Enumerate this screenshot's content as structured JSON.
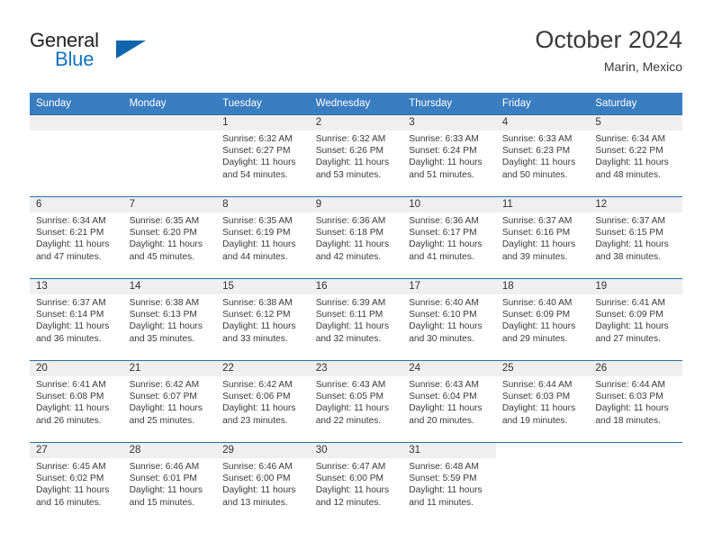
{
  "brand": {
    "word_one": "General",
    "word_two": "Blue",
    "triangle_icon": "triangle-logo-icon"
  },
  "header": {
    "month_title": "October 2024",
    "location": "Marin, Mexico"
  },
  "calendar": {
    "weekday_headers": [
      "Sunday",
      "Monday",
      "Tuesday",
      "Wednesday",
      "Thursday",
      "Friday",
      "Saturday"
    ],
    "labels": {
      "sunrise_prefix": "Sunrise:",
      "sunset_prefix": "Sunset:",
      "daylight_prefix": "Daylight:"
    },
    "weeks": [
      [
        {
          "day": "",
          "sunrise": "",
          "sunset": "",
          "daylight_line1": "",
          "daylight_line2": ""
        },
        {
          "day": "",
          "sunrise": "",
          "sunset": "",
          "daylight_line1": "",
          "daylight_line2": ""
        },
        {
          "day": "1",
          "sunrise": "Sunrise: 6:32 AM",
          "sunset": "Sunset: 6:27 PM",
          "daylight_line1": "Daylight: 11 hours",
          "daylight_line2": "and 54 minutes."
        },
        {
          "day": "2",
          "sunrise": "Sunrise: 6:32 AM",
          "sunset": "Sunset: 6:26 PM",
          "daylight_line1": "Daylight: 11 hours",
          "daylight_line2": "and 53 minutes."
        },
        {
          "day": "3",
          "sunrise": "Sunrise: 6:33 AM",
          "sunset": "Sunset: 6:24 PM",
          "daylight_line1": "Daylight: 11 hours",
          "daylight_line2": "and 51 minutes."
        },
        {
          "day": "4",
          "sunrise": "Sunrise: 6:33 AM",
          "sunset": "Sunset: 6:23 PM",
          "daylight_line1": "Daylight: 11 hours",
          "daylight_line2": "and 50 minutes."
        },
        {
          "day": "5",
          "sunrise": "Sunrise: 6:34 AM",
          "sunset": "Sunset: 6:22 PM",
          "daylight_line1": "Daylight: 11 hours",
          "daylight_line2": "and 48 minutes."
        }
      ],
      [
        {
          "day": "6",
          "sunrise": "Sunrise: 6:34 AM",
          "sunset": "Sunset: 6:21 PM",
          "daylight_line1": "Daylight: 11 hours",
          "daylight_line2": "and 47 minutes."
        },
        {
          "day": "7",
          "sunrise": "Sunrise: 6:35 AM",
          "sunset": "Sunset: 6:20 PM",
          "daylight_line1": "Daylight: 11 hours",
          "daylight_line2": "and 45 minutes."
        },
        {
          "day": "8",
          "sunrise": "Sunrise: 6:35 AM",
          "sunset": "Sunset: 6:19 PM",
          "daylight_line1": "Daylight: 11 hours",
          "daylight_line2": "and 44 minutes."
        },
        {
          "day": "9",
          "sunrise": "Sunrise: 6:36 AM",
          "sunset": "Sunset: 6:18 PM",
          "daylight_line1": "Daylight: 11 hours",
          "daylight_line2": "and 42 minutes."
        },
        {
          "day": "10",
          "sunrise": "Sunrise: 6:36 AM",
          "sunset": "Sunset: 6:17 PM",
          "daylight_line1": "Daylight: 11 hours",
          "daylight_line2": "and 41 minutes."
        },
        {
          "day": "11",
          "sunrise": "Sunrise: 6:37 AM",
          "sunset": "Sunset: 6:16 PM",
          "daylight_line1": "Daylight: 11 hours",
          "daylight_line2": "and 39 minutes."
        },
        {
          "day": "12",
          "sunrise": "Sunrise: 6:37 AM",
          "sunset": "Sunset: 6:15 PM",
          "daylight_line1": "Daylight: 11 hours",
          "daylight_line2": "and 38 minutes."
        }
      ],
      [
        {
          "day": "13",
          "sunrise": "Sunrise: 6:37 AM",
          "sunset": "Sunset: 6:14 PM",
          "daylight_line1": "Daylight: 11 hours",
          "daylight_line2": "and 36 minutes."
        },
        {
          "day": "14",
          "sunrise": "Sunrise: 6:38 AM",
          "sunset": "Sunset: 6:13 PM",
          "daylight_line1": "Daylight: 11 hours",
          "daylight_line2": "and 35 minutes."
        },
        {
          "day": "15",
          "sunrise": "Sunrise: 6:38 AM",
          "sunset": "Sunset: 6:12 PM",
          "daylight_line1": "Daylight: 11 hours",
          "daylight_line2": "and 33 minutes."
        },
        {
          "day": "16",
          "sunrise": "Sunrise: 6:39 AM",
          "sunset": "Sunset: 6:11 PM",
          "daylight_line1": "Daylight: 11 hours",
          "daylight_line2": "and 32 minutes."
        },
        {
          "day": "17",
          "sunrise": "Sunrise: 6:40 AM",
          "sunset": "Sunset: 6:10 PM",
          "daylight_line1": "Daylight: 11 hours",
          "daylight_line2": "and 30 minutes."
        },
        {
          "day": "18",
          "sunrise": "Sunrise: 6:40 AM",
          "sunset": "Sunset: 6:09 PM",
          "daylight_line1": "Daylight: 11 hours",
          "daylight_line2": "and 29 minutes."
        },
        {
          "day": "19",
          "sunrise": "Sunrise: 6:41 AM",
          "sunset": "Sunset: 6:09 PM",
          "daylight_line1": "Daylight: 11 hours",
          "daylight_line2": "and 27 minutes."
        }
      ],
      [
        {
          "day": "20",
          "sunrise": "Sunrise: 6:41 AM",
          "sunset": "Sunset: 6:08 PM",
          "daylight_line1": "Daylight: 11 hours",
          "daylight_line2": "and 26 minutes."
        },
        {
          "day": "21",
          "sunrise": "Sunrise: 6:42 AM",
          "sunset": "Sunset: 6:07 PM",
          "daylight_line1": "Daylight: 11 hours",
          "daylight_line2": "and 25 minutes."
        },
        {
          "day": "22",
          "sunrise": "Sunrise: 6:42 AM",
          "sunset": "Sunset: 6:06 PM",
          "daylight_line1": "Daylight: 11 hours",
          "daylight_line2": "and 23 minutes."
        },
        {
          "day": "23",
          "sunrise": "Sunrise: 6:43 AM",
          "sunset": "Sunset: 6:05 PM",
          "daylight_line1": "Daylight: 11 hours",
          "daylight_line2": "and 22 minutes."
        },
        {
          "day": "24",
          "sunrise": "Sunrise: 6:43 AM",
          "sunset": "Sunset: 6:04 PM",
          "daylight_line1": "Daylight: 11 hours",
          "daylight_line2": "and 20 minutes."
        },
        {
          "day": "25",
          "sunrise": "Sunrise: 6:44 AM",
          "sunset": "Sunset: 6:03 PM",
          "daylight_line1": "Daylight: 11 hours",
          "daylight_line2": "and 19 minutes."
        },
        {
          "day": "26",
          "sunrise": "Sunrise: 6:44 AM",
          "sunset": "Sunset: 6:03 PM",
          "daylight_line1": "Daylight: 11 hours",
          "daylight_line2": "and 18 minutes."
        }
      ],
      [
        {
          "day": "27",
          "sunrise": "Sunrise: 6:45 AM",
          "sunset": "Sunset: 6:02 PM",
          "daylight_line1": "Daylight: 11 hours",
          "daylight_line2": "and 16 minutes."
        },
        {
          "day": "28",
          "sunrise": "Sunrise: 6:46 AM",
          "sunset": "Sunset: 6:01 PM",
          "daylight_line1": "Daylight: 11 hours",
          "daylight_line2": "and 15 minutes."
        },
        {
          "day": "29",
          "sunrise": "Sunrise: 6:46 AM",
          "sunset": "Sunset: 6:00 PM",
          "daylight_line1": "Daylight: 11 hours",
          "daylight_line2": "and 13 minutes."
        },
        {
          "day": "30",
          "sunrise": "Sunrise: 6:47 AM",
          "sunset": "Sunset: 6:00 PM",
          "daylight_line1": "Daylight: 11 hours",
          "daylight_line2": "and 12 minutes."
        },
        {
          "day": "31",
          "sunrise": "Sunrise: 6:48 AM",
          "sunset": "Sunset: 5:59 PM",
          "daylight_line1": "Daylight: 11 hours",
          "daylight_line2": "and 11 minutes."
        },
        {
          "day": "",
          "sunrise": "",
          "sunset": "",
          "daylight_line1": "",
          "daylight_line2": ""
        },
        {
          "day": "",
          "sunrise": "",
          "sunset": "",
          "daylight_line1": "",
          "daylight_line2": ""
        }
      ]
    ]
  },
  "colors": {
    "header_blue": "#3a7dc0",
    "grid_blue": "#2e6da4",
    "brand_blue": "#1273c4",
    "band_gray": "#efefef"
  }
}
